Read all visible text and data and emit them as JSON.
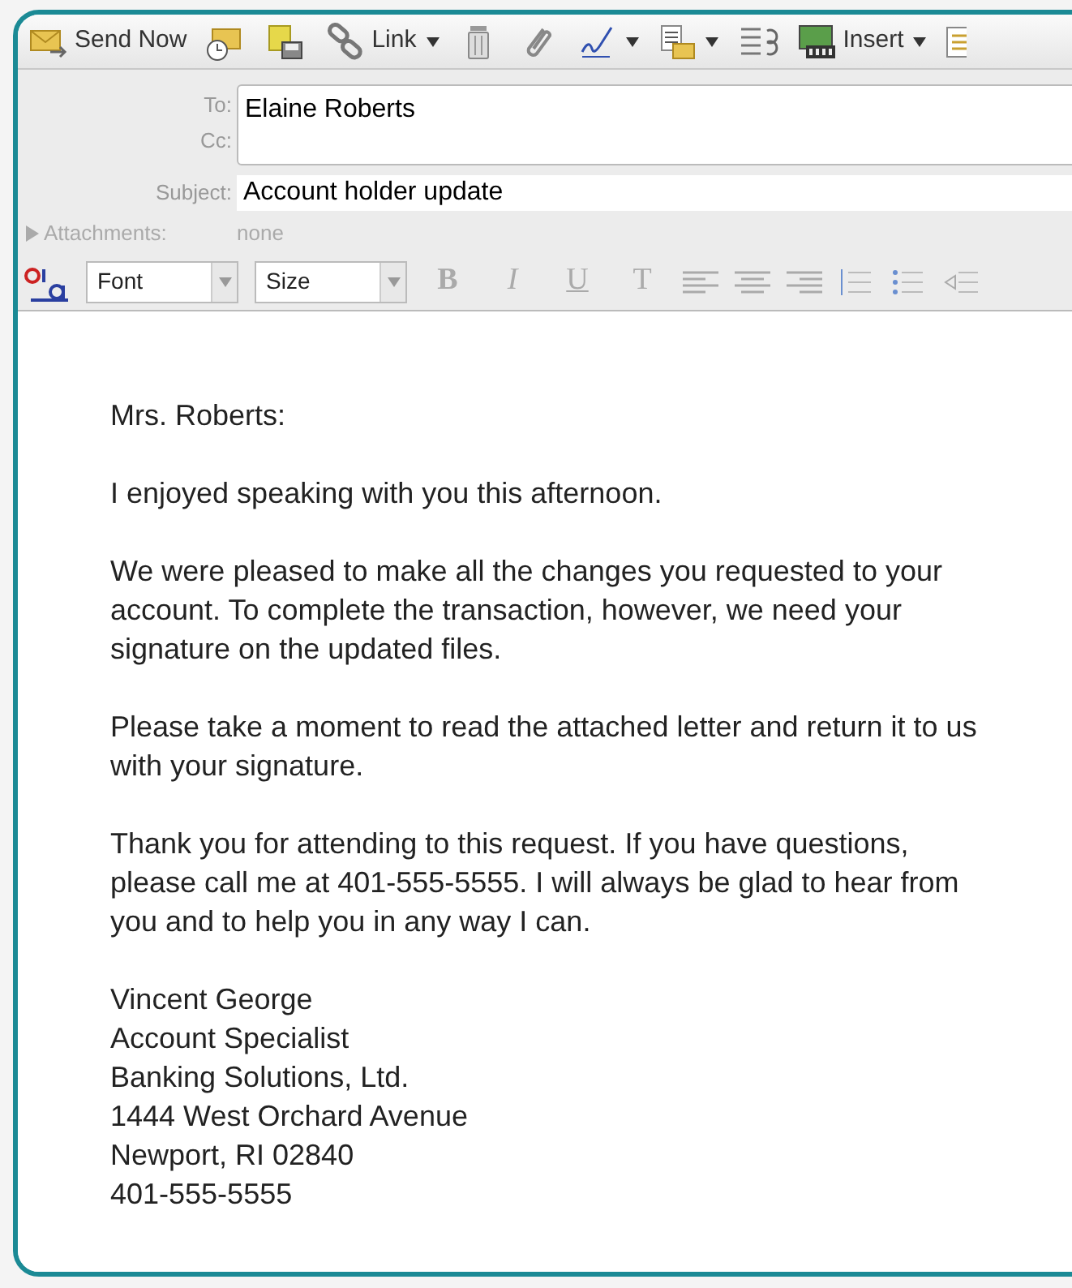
{
  "toolbar": [
    {
      "kind": "send",
      "label": "Send Now"
    },
    {
      "kind": "schedule"
    },
    {
      "kind": "note"
    },
    {
      "kind": "link",
      "label": "Link",
      "dropdown": true
    },
    {
      "kind": "trash"
    },
    {
      "kind": "clip"
    },
    {
      "kind": "signature",
      "dropdown": true
    },
    {
      "kind": "list",
      "dropdown": true
    },
    {
      "kind": "rules"
    },
    {
      "kind": "insert",
      "label": "Insert",
      "dropdown": true
    },
    {
      "kind": "table"
    }
  ],
  "header": {
    "to_label": "To:",
    "to": "Elaine Roberts",
    "cc_label": "Cc:",
    "subject_label": "Subject:",
    "subject": "Account holder update",
    "attachments_label": "Attachments:",
    "attachments": "none"
  },
  "format_bar": {
    "font": "Font",
    "size": "Size",
    "styles": [
      "B",
      "I",
      "U",
      "T"
    ]
  },
  "body": {
    "greeting": "Mrs. Roberts:",
    "paragraphs": [
      "I enjoyed speaking with you this afternoon.",
      "We were pleased to make all the changes you requested to your account. To complete the transaction, however, we need your signature on the updated files.",
      "Please take a moment to read the attached letter and return it to us with your signature.",
      "Thank you for attending to this request. If you have questions, please call me at 401-555-5555. I will always be glad to hear from you and to help you in any way I can."
    ],
    "signature": [
      "Vincent George",
      "Account Specialist",
      "Banking Solutions, Ltd.",
      "1444 West Orchard Avenue",
      "Newport, RI 02840",
      "401-555-5555"
    ]
  }
}
